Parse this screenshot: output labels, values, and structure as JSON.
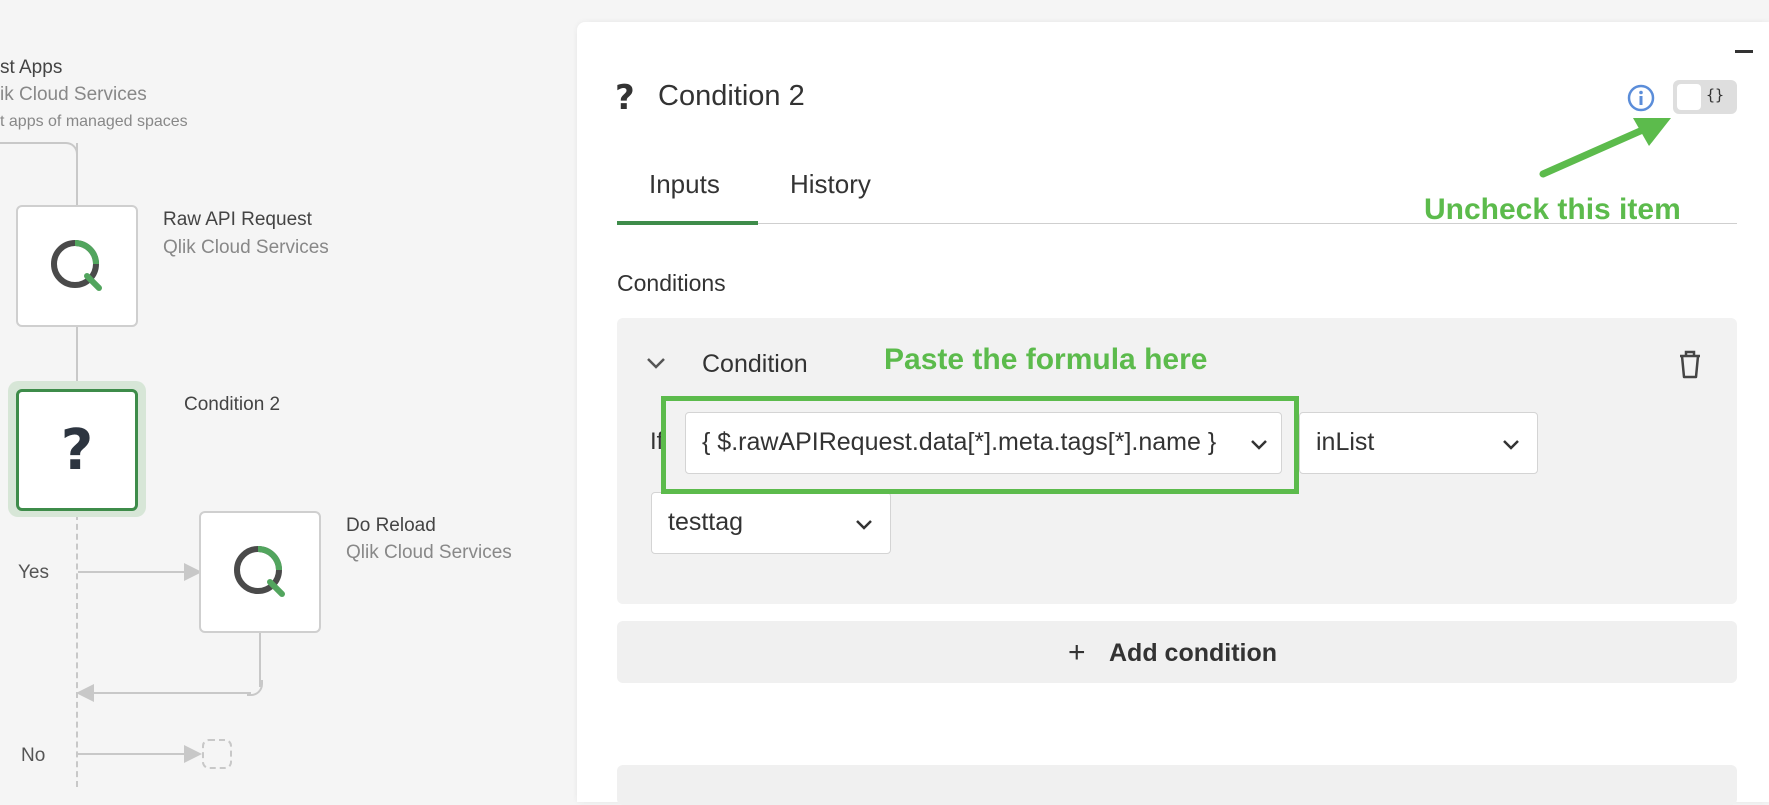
{
  "canvas": {
    "nodes": {
      "list_apps": {
        "title": "st Apps",
        "service": "ik Cloud Services",
        "description": "t apps of managed spaces"
      },
      "raw_api": {
        "title": "Raw API Request",
        "service": "Qlik Cloud Services",
        "icon": "qlik-logo-icon"
      },
      "condition": {
        "title": "Condition 2",
        "icon": "question-mark-icon"
      },
      "do_reload": {
        "title": "Do Reload",
        "service": "Qlik Cloud Services",
        "icon": "qlik-logo-icon"
      }
    },
    "branches": {
      "yes": "Yes",
      "no": "No"
    }
  },
  "panel": {
    "title": "Condition 2",
    "toggle_label": "{}",
    "tabs": [
      {
        "label": "Inputs",
        "active": true
      },
      {
        "label": "History",
        "active": false
      }
    ],
    "section_label": "Conditions",
    "condition": {
      "heading": "Condition",
      "if_label": "If",
      "left_operand": "{ $.rawAPIRequest.data[*].meta.tags[*].name }",
      "operator": "inList",
      "right_operand": "testtag"
    },
    "add_condition_label": "Add condition"
  },
  "annotations": {
    "paste_formula": "Paste the formula here",
    "uncheck_item": "Uncheck this item",
    "color": "#5cbb4c"
  },
  "colors": {
    "accent_green": "#3e8c4a",
    "qlik_green": "#52a55e",
    "qlik_gray": "#4a4a4a"
  }
}
